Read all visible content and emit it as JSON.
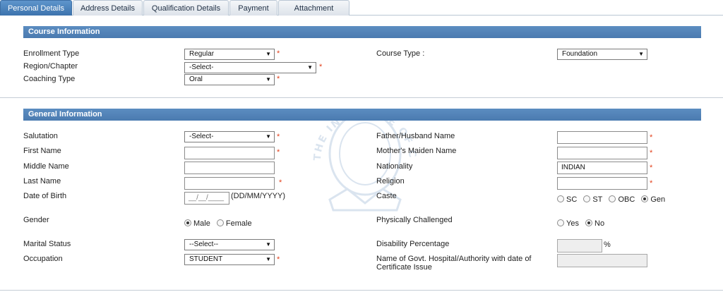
{
  "tabs": [
    {
      "label": "Personal Details",
      "active": true
    },
    {
      "label": "Address Details",
      "active": false
    },
    {
      "label": "Qualification Details",
      "active": false
    },
    {
      "label": "Payment",
      "active": false
    },
    {
      "label": "Attachment",
      "active": false
    }
  ],
  "required_mark": "*",
  "course": {
    "title": "Course Information",
    "enrollment_type": {
      "label": "Enrollment Type",
      "value": "Regular"
    },
    "region": {
      "label": "Region/Chapter",
      "value": "-Select-"
    },
    "coaching_type": {
      "label": "Coaching Type",
      "value": "Oral"
    },
    "course_type": {
      "label": "Course Type :",
      "value": "Foundation"
    }
  },
  "general": {
    "title": "General Information",
    "salutation": {
      "label": "Salutation",
      "value": "-Select-"
    },
    "first_name": {
      "label": "First Name",
      "value": ""
    },
    "middle_name": {
      "label": "Middle Name",
      "value": ""
    },
    "last_name": {
      "label": "Last Name",
      "value": ""
    },
    "dob": {
      "label": "Date of Birth",
      "value": "__/__/____",
      "hint": "(DD/MM/YYYY)"
    },
    "gender": {
      "label": "Gender",
      "options": [
        "Male",
        "Female"
      ],
      "selected": "Male"
    },
    "marital_status": {
      "label": "Marital Status",
      "value": "--Select--"
    },
    "occupation": {
      "label": "Occupation",
      "value": "STUDENT"
    },
    "father_name": {
      "label": "Father/Husband Name",
      "value": ""
    },
    "mother_name": {
      "label": "Mother's Maiden Name",
      "value": ""
    },
    "nationality": {
      "label": "Nationality",
      "value": "INDIAN"
    },
    "religion": {
      "label": "Religion",
      "value": ""
    },
    "caste": {
      "label": "Caste",
      "options": [
        "SC",
        "ST",
        "OBC",
        "Gen"
      ],
      "selected": "Gen"
    },
    "physically_challenged": {
      "label": "Physically Challenged",
      "options": [
        "Yes",
        "No"
      ],
      "selected": "No"
    },
    "disability_percentage": {
      "label": "Disability Percentage",
      "value": "",
      "unit": "%"
    },
    "govt_hospital": {
      "label_line1": "Name of Govt. Hospital/Authority with date of",
      "label_line2": "Certificate Issue",
      "value": ""
    }
  },
  "watermark": {
    "text": "THE INSTITUTE OF COST ACCOUNTANTS"
  },
  "icons": {
    "dropdown": "chevron-down-icon",
    "radio": "radio-icon"
  },
  "colors": {
    "tab_active": "#4a80bb",
    "section_bar": "#5585bb",
    "required": "#e2401b"
  }
}
